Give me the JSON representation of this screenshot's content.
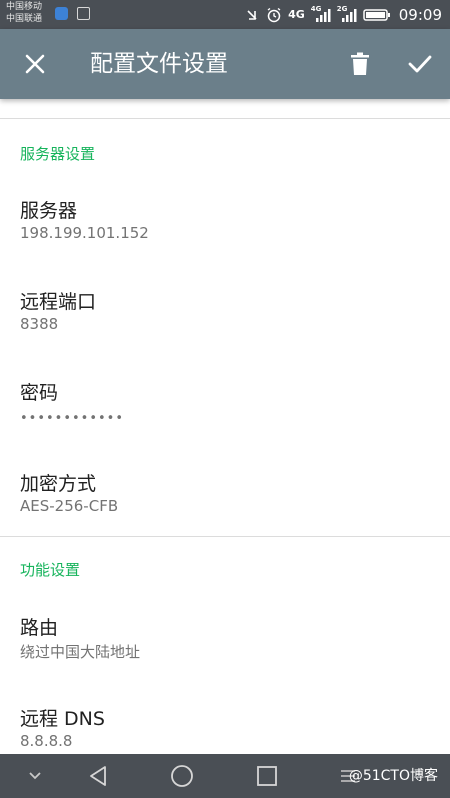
{
  "status_bar": {
    "carrier_1": "中国移动",
    "carrier_2": "中国联通",
    "network_1": "4G",
    "network_2": "4G",
    "network_3": "2G",
    "time": "09:09"
  },
  "app_bar": {
    "title": "配置文件设置"
  },
  "sections": {
    "server": {
      "header": "服务器设置",
      "server": {
        "title": "服务器",
        "value": "198.199.101.152"
      },
      "remote_port": {
        "title": "远程端口",
        "value": "8388"
      },
      "password": {
        "title": "密码",
        "value": "••••••••••••"
      },
      "encryption": {
        "title": "加密方式",
        "value": "AES-256-CFB"
      }
    },
    "features": {
      "header": "功能设置",
      "route": {
        "title": "路由",
        "value": "绕过中国大陆地址"
      },
      "remote_dns": {
        "title": "远程 DNS",
        "value": "8.8.8.8"
      }
    }
  },
  "watermark": "@51CTO博客",
  "colors": {
    "app_bar": "#6b7f8a",
    "status_bar": "#4a4f55",
    "section_header": "#17b45c",
    "summary_text": "#737373"
  },
  "icons": [
    "close-icon",
    "delete-icon",
    "check-icon",
    "back-nav-icon",
    "home-nav-icon",
    "recents-nav-icon",
    "chevron-down-icon"
  ]
}
